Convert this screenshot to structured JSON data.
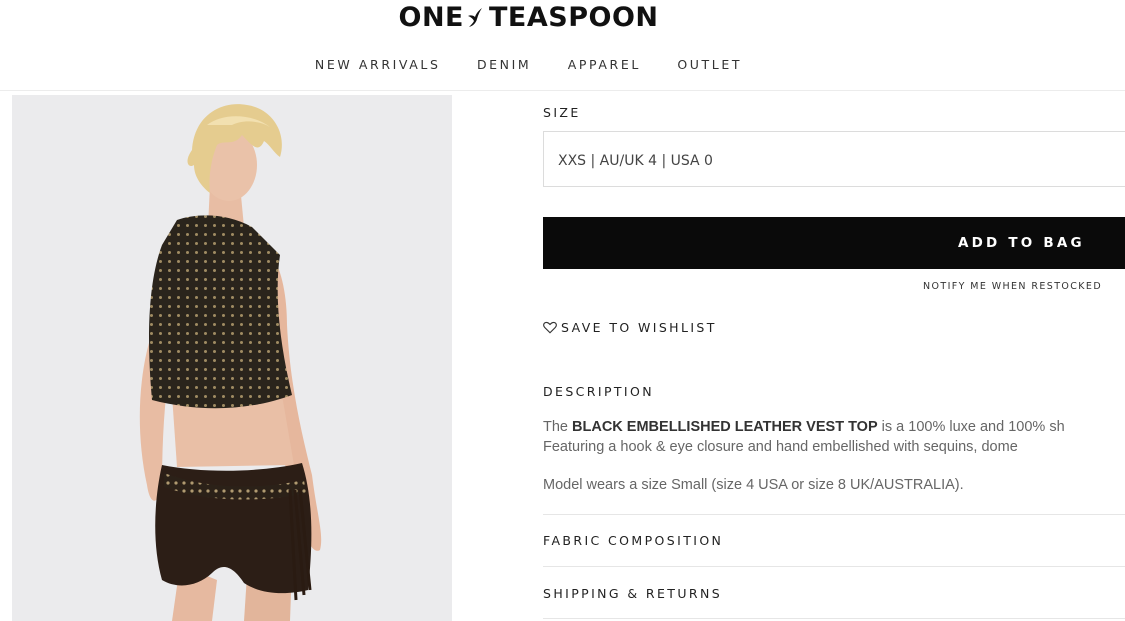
{
  "brand": {
    "name_left": "ONE",
    "name_right": "TEASPOON"
  },
  "nav": {
    "items": [
      "NEW ARRIVALS",
      "DENIM",
      "APPAREL",
      "OUTLET"
    ]
  },
  "product": {
    "image_alt": "Model wearing black embellished leather vest top and fringed suede shorts, back view",
    "size_label": "SIZE",
    "size_selected": "XXS | AU/UK 4 | USA 0",
    "add_to_bag": "ADD TO BAG",
    "notify": "NOTIFY ME WHEN RESTOCKED",
    "wishlist": "SAVE TO WISHLIST",
    "description_label": "DESCRIPTION",
    "description_prefix": "The",
    "description_name": "BLACK EMBELLISHED LEATHER VEST TOP",
    "description_line1_rest": "is a 100% luxe and 100% sh",
    "description_line2": "Featuring a hook & eye closure and hand embellished with sequins, dome",
    "model_note": "Model wears a size Small (size 4 USA or size 8 UK/AUSTRALIA).",
    "fabric_label": "FABRIC COMPOSITION",
    "shipping_label": "SHIPPING & RETURNS"
  },
  "colors": {
    "accent": "#0a0a0a",
    "text": "#222222",
    "muted": "#666666"
  }
}
